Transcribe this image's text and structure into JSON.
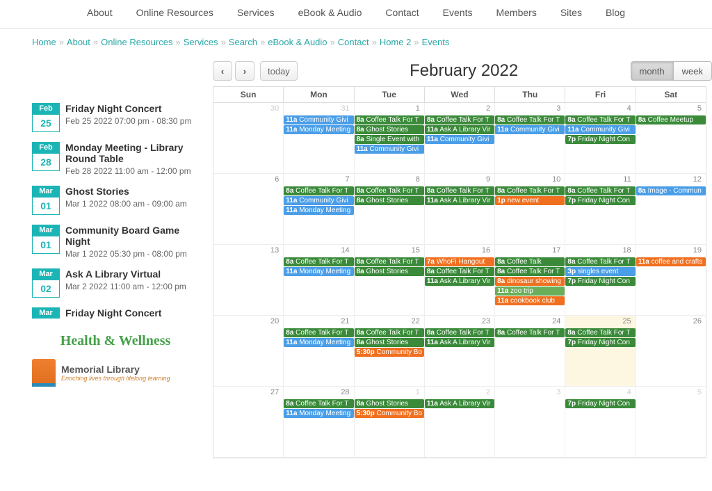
{
  "topnav": [
    "About",
    "Online Resources",
    "Services",
    "eBook & Audio",
    "Contact",
    "Events",
    "Members",
    "Sites",
    "Blog"
  ],
  "breadcrumb": [
    "Home",
    "About",
    "Online Resources",
    "Services",
    "Search",
    "eBook & Audio",
    "Contact",
    "Home 2",
    "Events"
  ],
  "sidebar_events": [
    {
      "mon": "Feb",
      "day": "25",
      "title": "Friday Night Concert",
      "time": "Feb 25 2022 07:00 pm - 08:30 pm"
    },
    {
      "mon": "Feb",
      "day": "28",
      "title": "Monday Meeting - Library Round Table",
      "time": "Feb 28 2022 11:00 am - 12:00 pm"
    },
    {
      "mon": "Mar",
      "day": "01",
      "title": "Ghost Stories",
      "time": "Mar 1 2022 08:00 am - 09:00 am"
    },
    {
      "mon": "Mar",
      "day": "01",
      "title": "Community Board Game Night",
      "time": "Mar 1 2022 05:30 pm - 08:00 pm"
    },
    {
      "mon": "Mar",
      "day": "02",
      "title": "Ask A Library Virtual",
      "time": "Mar 2 2022 11:00 am - 12:00 pm"
    },
    {
      "mon": "Mar",
      "day": "",
      "title": "Friday Night Concert",
      "time": ""
    }
  ],
  "hw_title": "Health & Wellness",
  "logo_name": "Memorial Library",
  "logo_tag": "Enriching lives through lifelong learning",
  "cal": {
    "title": "February 2022",
    "today": "today",
    "views": {
      "month": "month",
      "week": "week"
    },
    "dow": [
      "Sun",
      "Mon",
      "Tue",
      "Wed",
      "Thu",
      "Fri",
      "Sat"
    ],
    "weeks": [
      [
        {
          "n": "30",
          "other": true,
          "ev": []
        },
        {
          "n": "31",
          "other": true,
          "ev": [
            [
              "blue",
              "11a",
              "Community Givi"
            ],
            [
              "blue",
              "11a",
              "Monday Meeting"
            ]
          ]
        },
        {
          "n": "1",
          "ev": [
            [
              "green",
              "8a",
              "Coffee Talk For T"
            ],
            [
              "green",
              "8a",
              "Ghost Stories"
            ],
            [
              "green",
              "8a",
              "Single Event with"
            ],
            [
              "blue",
              "11a",
              "Community Givi"
            ]
          ]
        },
        {
          "n": "2",
          "ev": [
            [
              "green",
              "8a",
              "Coffee Talk For T"
            ],
            [
              "green",
              "11a",
              "Ask A Library Vir"
            ],
            [
              "blue",
              "11a",
              "Community Givi"
            ]
          ]
        },
        {
          "n": "3",
          "ev": [
            [
              "green",
              "8a",
              "Coffee Talk For T"
            ],
            [
              "blue",
              "11a",
              "Community Givi"
            ]
          ]
        },
        {
          "n": "4",
          "ev": [
            [
              "green",
              "8a",
              "Coffee Talk For T"
            ],
            [
              "blue",
              "11a",
              "Community Givi"
            ],
            [
              "green",
              "7p",
              "Friday Night Con"
            ]
          ]
        },
        {
          "n": "5",
          "ev": [
            [
              "green",
              "8a",
              "Coffee Meetup"
            ]
          ]
        }
      ],
      [
        {
          "n": "6",
          "ev": []
        },
        {
          "n": "7",
          "ev": [
            [
              "green",
              "8a",
              "Coffee Talk For T"
            ],
            [
              "blue",
              "11a",
              "Community Givi"
            ],
            [
              "blue",
              "11a",
              "Monday Meeting"
            ]
          ]
        },
        {
          "n": "8",
          "ev": [
            [
              "green",
              "8a",
              "Coffee Talk For T"
            ],
            [
              "green",
              "8a",
              "Ghost Stories"
            ]
          ]
        },
        {
          "n": "9",
          "ev": [
            [
              "green",
              "8a",
              "Coffee Talk For T"
            ],
            [
              "green",
              "11a",
              "Ask A Library Vir"
            ]
          ]
        },
        {
          "n": "10",
          "ev": [
            [
              "green",
              "8a",
              "Coffee Talk For T"
            ],
            [
              "orange",
              "1p",
              "new event"
            ]
          ]
        },
        {
          "n": "11",
          "ev": [
            [
              "green",
              "8a",
              "Coffee Talk For T"
            ],
            [
              "green",
              "7p",
              "Friday Night Con"
            ]
          ]
        },
        {
          "n": "12",
          "ev": [
            [
              "blue",
              "8a",
              "Image - Commun"
            ]
          ]
        }
      ],
      [
        {
          "n": "13",
          "ev": []
        },
        {
          "n": "14",
          "ev": [
            [
              "green",
              "8a",
              "Coffee Talk For T"
            ],
            [
              "blue",
              "11a",
              "Monday Meeting"
            ]
          ]
        },
        {
          "n": "15",
          "ev": [
            [
              "green",
              "8a",
              "Coffee Talk For T"
            ],
            [
              "green",
              "8a",
              "Ghost Stories"
            ]
          ]
        },
        {
          "n": "16",
          "ev": [
            [
              "orange",
              "7a",
              "WhoFi Hangout"
            ],
            [
              "green",
              "8a",
              "Coffee Talk For T"
            ],
            [
              "green",
              "11a",
              "Ask A Library Vir"
            ]
          ]
        },
        {
          "n": "17",
          "ev": [
            [
              "green",
              "8a",
              "Coffee Talk"
            ],
            [
              "green",
              "8a",
              "Coffee Talk For T"
            ],
            [
              "orange",
              "8a",
              "dinosaur showing"
            ],
            [
              "lightgreen",
              "11a",
              "zoo trip"
            ],
            [
              "orange",
              "11a",
              "cookbook club"
            ]
          ]
        },
        {
          "n": "18",
          "ev": [
            [
              "green",
              "8a",
              "Coffee Talk For T"
            ],
            [
              "blue",
              "3p",
              "singles event"
            ],
            [
              "green",
              "7p",
              "Friday Night Con"
            ]
          ]
        },
        {
          "n": "19",
          "ev": [
            [
              "orange",
              "11a",
              "coffee and crafts"
            ]
          ]
        }
      ],
      [
        {
          "n": "20",
          "ev": []
        },
        {
          "n": "21",
          "ev": [
            [
              "green",
              "8a",
              "Coffee Talk For T"
            ],
            [
              "blue",
              "11a",
              "Monday Meeting"
            ]
          ]
        },
        {
          "n": "22",
          "ev": [
            [
              "green",
              "8a",
              "Coffee Talk For T"
            ],
            [
              "green",
              "8a",
              "Ghost Stories"
            ],
            [
              "orange",
              "5:30p",
              "Community Bo"
            ]
          ]
        },
        {
          "n": "23",
          "ev": [
            [
              "green",
              "8a",
              "Coffee Talk For T"
            ],
            [
              "green",
              "11a",
              "Ask A Library Vir"
            ]
          ]
        },
        {
          "n": "24",
          "ev": [
            [
              "green",
              "8a",
              "Coffee Talk For T"
            ]
          ]
        },
        {
          "n": "25",
          "today": true,
          "ev": [
            [
              "green",
              "8a",
              "Coffee Talk For T"
            ],
            [
              "green",
              "7p",
              "Friday Night Con"
            ]
          ]
        },
        {
          "n": "26",
          "ev": []
        }
      ],
      [
        {
          "n": "27",
          "ev": []
        },
        {
          "n": "28",
          "ev": [
            [
              "green",
              "8a",
              "Coffee Talk For T"
            ],
            [
              "blue",
              "11a",
              "Monday Meeting"
            ]
          ]
        },
        {
          "n": "1",
          "other": true,
          "ev": [
            [
              "green",
              "8a",
              "Ghost Stories"
            ],
            [
              "orange",
              "5:30p",
              "Community Bo"
            ]
          ]
        },
        {
          "n": "2",
          "other": true,
          "ev": [
            [
              "green",
              "11a",
              "Ask A Library Vir"
            ]
          ]
        },
        {
          "n": "3",
          "other": true,
          "ev": []
        },
        {
          "n": "4",
          "other": true,
          "ev": [
            [
              "green",
              "7p",
              "Friday Night Con"
            ]
          ]
        },
        {
          "n": "5",
          "other": true,
          "ev": []
        }
      ]
    ]
  }
}
